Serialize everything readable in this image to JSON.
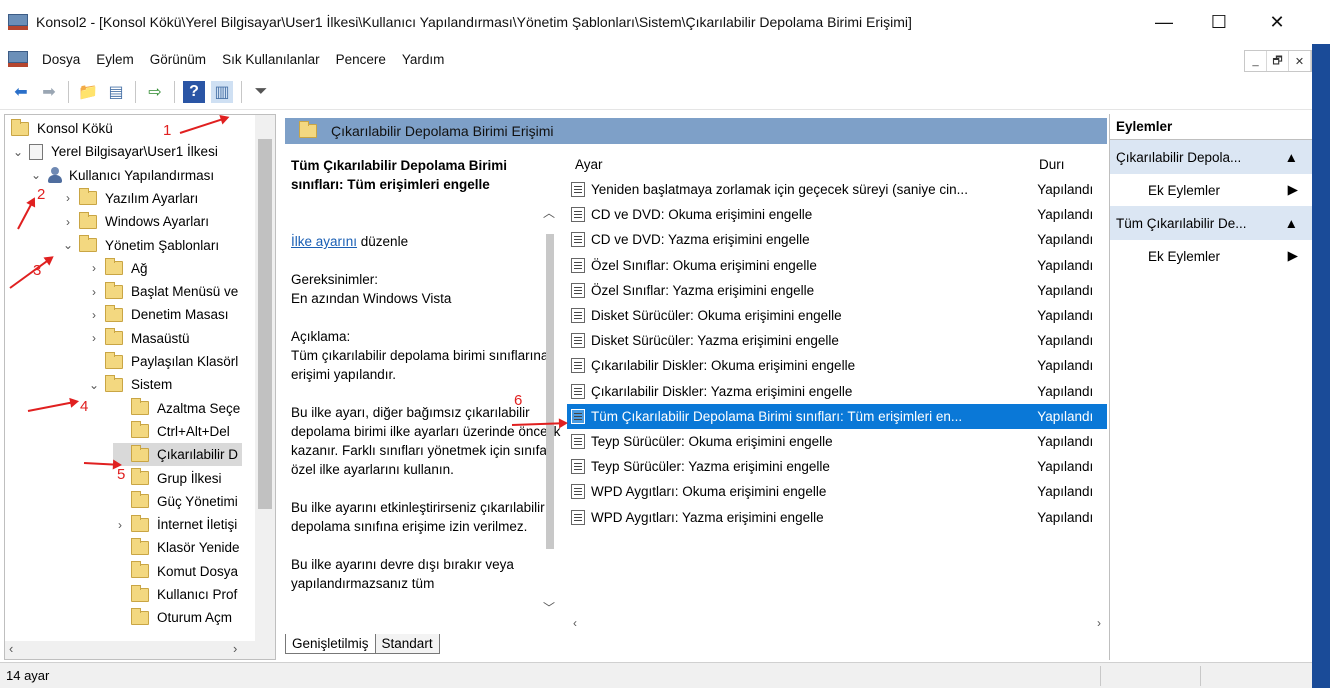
{
  "window": {
    "title": "Konsol2 - [Konsol Kökü\\Yerel Bilgisayar\\User1 İlkesi\\Kullanıcı Yapılandırması\\Yönetim Şablonları\\Sistem\\Çıkarılabilir Depolama Birimi Erişimi]",
    "minimize_glyph": "—",
    "maximize_glyph": "☐",
    "close_glyph": "✕"
  },
  "menu": {
    "items": [
      "Dosya",
      "Eylem",
      "Görünüm",
      "Sık Kullanılanlar",
      "Pencere",
      "Yardım"
    ],
    "mdi": [
      "_",
      "🗗",
      "✕"
    ]
  },
  "toolbar": {
    "icons": [
      "back-arrow-icon",
      "forward-arrow-icon",
      "up-folder-icon",
      "show-hide-tree-icon",
      "export-list-icon",
      "help-icon",
      "show-action-pane-icon",
      "filter-icon"
    ],
    "glyphs": [
      "⬅",
      "➡",
      "📁",
      "▤",
      "⇨",
      "?",
      "▥",
      "⏷"
    ]
  },
  "tree": {
    "items": [
      {
        "label": "Konsol Kökü",
        "chev": "",
        "icon": "folder",
        "indent": 0
      },
      {
        "label": "Yerel Bilgisayar\\User1 İlkesi",
        "chev": "⌄",
        "icon": "doc",
        "indent": 0
      },
      {
        "label": "Kullanıcı Yapılandırması",
        "chev": "⌄",
        "icon": "user",
        "indent": 1
      },
      {
        "label": "Yazılım Ayarları",
        "chev": "›",
        "icon": "folder",
        "indent": 2
      },
      {
        "label": "Windows Ayarları",
        "chev": "›",
        "icon": "folder",
        "indent": 2
      },
      {
        "label": "Yönetim Şablonları",
        "chev": "⌄",
        "icon": "folder",
        "indent": 2
      },
      {
        "label": "Ağ",
        "chev": "›",
        "icon": "folder",
        "indent": 3
      },
      {
        "label": "Başlat Menüsü ve",
        "chev": "›",
        "icon": "folder",
        "indent": 3
      },
      {
        "label": "Denetim Masası",
        "chev": "›",
        "icon": "folder",
        "indent": 3
      },
      {
        "label": "Masaüstü",
        "chev": "›",
        "icon": "folder",
        "indent": 3
      },
      {
        "label": "Paylaşılan Klasörl",
        "chev": "",
        "icon": "folder",
        "indent": 3
      },
      {
        "label": "Sistem",
        "chev": "⌄",
        "icon": "folder",
        "indent": 3
      },
      {
        "label": "Azaltma Seçe",
        "chev": "",
        "icon": "folder",
        "indent": 4
      },
      {
        "label": "Ctrl+Alt+Del",
        "chev": "",
        "icon": "folder",
        "indent": 4
      },
      {
        "label": "Çıkarılabilir D",
        "chev": "",
        "icon": "folder",
        "indent": 4,
        "selected": true
      },
      {
        "label": "Grup İlkesi",
        "chev": "",
        "icon": "folder",
        "indent": 4
      },
      {
        "label": "Güç Yönetimi",
        "chev": "",
        "icon": "folder",
        "indent": 4
      },
      {
        "label": "İnternet İletişi",
        "chev": "›",
        "icon": "folder",
        "indent": 4
      },
      {
        "label": "Klasör Yenide",
        "chev": "",
        "icon": "folder",
        "indent": 4
      },
      {
        "label": "Komut Dosya",
        "chev": "",
        "icon": "folder",
        "indent": 4
      },
      {
        "label": "Kullanıcı Prof",
        "chev": "",
        "icon": "folder",
        "indent": 4
      },
      {
        "label": "Oturum Açm",
        "chev": "",
        "icon": "folder",
        "indent": 4
      }
    ]
  },
  "middle": {
    "header": "Çıkarılabilir Depolama Birimi Erişimi",
    "desc": {
      "title": "Tüm Çıkarılabilir Depolama Birimi sınıfları: Tüm erişimleri engelle",
      "link": "İlke ayarını",
      "link_suffix": " düzenle",
      "req_label": "Gereksinimler:",
      "req_value": "En azından Windows Vista",
      "desc_label": "Açıklama:",
      "desc_text": "Tüm çıkarılabilir depolama birimi sınıflarına erişimi yapılandır.",
      "para1": "Bu ilke ayarı, diğer bağımsız çıkarılabilir depolama birimi ilke ayarları üzerinde öncelik kazanır. Farklı sınıfları yönetmek için sınıfa özel ilke ayarlarını kullanın.",
      "para2": "Bu ilke ayarını etkinleştirirseniz çıkarılabilir depolama sınıfına erişime izin verilmez.",
      "para3": "Bu ilke ayarını devre dışı bırakır veya yapılandırmazsanız tüm"
    },
    "columns": {
      "setting": "Ayar",
      "state": "Durı"
    },
    "rows": [
      {
        "name": "Yeniden başlatmaya zorlamak için geçecek süreyi (saniye cin...",
        "state": "Yapılandı"
      },
      {
        "name": "CD ve DVD: Okuma erişimini engelle",
        "state": "Yapılandı"
      },
      {
        "name": "CD ve DVD: Yazma erişimini engelle",
        "state": "Yapılandı"
      },
      {
        "name": "Özel Sınıflar: Okuma erişimini engelle",
        "state": "Yapılandı"
      },
      {
        "name": "Özel Sınıflar: Yazma erişimini engelle",
        "state": "Yapılandı"
      },
      {
        "name": "Disket Sürücüler: Okuma erişimini engelle",
        "state": "Yapılandı"
      },
      {
        "name": "Disket Sürücüler: Yazma erişimini engelle",
        "state": "Yapılandı"
      },
      {
        "name": "Çıkarılabilir Diskler: Okuma erişimini engelle",
        "state": "Yapılandı"
      },
      {
        "name": "Çıkarılabilir Diskler: Yazma erişimini engelle",
        "state": "Yapılandı"
      },
      {
        "name": "Tüm Çıkarılabilir Depolama Birimi sınıfları: Tüm erişimleri en...",
        "state": "Yapılandı",
        "selected": true
      },
      {
        "name": "Teyp Sürücüler: Okuma erişimini engelle",
        "state": "Yapılandı"
      },
      {
        "name": "Teyp Sürücüler: Yazma erişimini engelle",
        "state": "Yapılandı"
      },
      {
        "name": "WPD Aygıtları: Okuma erişimini engelle",
        "state": "Yapılandı"
      },
      {
        "name": "WPD Aygıtları: Yazma erişimini engelle",
        "state": "Yapılandı"
      }
    ],
    "tabs": [
      "Genişletilmiş",
      "Standart"
    ]
  },
  "actions": {
    "title": "Eylemler",
    "groups": [
      {
        "label": "Çıkarılabilir Depola...",
        "item": "Ek Eylemler"
      },
      {
        "label": "Tüm Çıkarılabilir De...",
        "item": "Ek Eylemler"
      }
    ]
  },
  "status": {
    "text": "14 ayar"
  },
  "annotations": [
    "1",
    "2",
    "3",
    "4",
    "5",
    "6"
  ],
  "colors": {
    "selection": "#0a78d7",
    "header": "#7ea0c8",
    "annotation": "#e02020",
    "edge": "#1a4b98"
  }
}
